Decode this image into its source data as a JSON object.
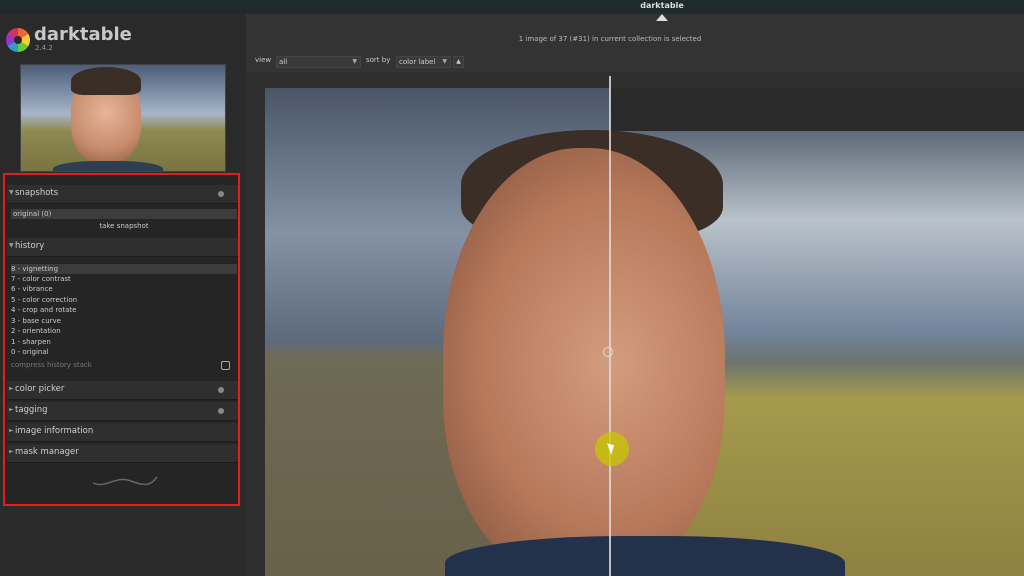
{
  "topbar": {
    "view_label": "darktable"
  },
  "app": {
    "name": "darktable",
    "version": "2.4.2"
  },
  "header": {
    "status": "1 image of 37 (#31) in current collection is selected",
    "view_label": "view",
    "view_value": "all",
    "sort_label": "sort by",
    "sort_value": "color label"
  },
  "panel": {
    "snapshots": {
      "title": "snapshots",
      "item": "original (0)",
      "button": "take snapshot"
    },
    "history": {
      "title": "history",
      "items": [
        "8 - vignetting",
        "7 - color contrast",
        "6 - vibrance",
        "5 - color correction",
        "4 - crop and rotate",
        "3 - base curve",
        "2 - orientation",
        "1 - sharpen",
        "0 - original"
      ],
      "compress": "compress history stack"
    },
    "color_picker": "color picker",
    "tagging": "tagging",
    "image_information": "image information",
    "mask_manager": "mask manager"
  }
}
